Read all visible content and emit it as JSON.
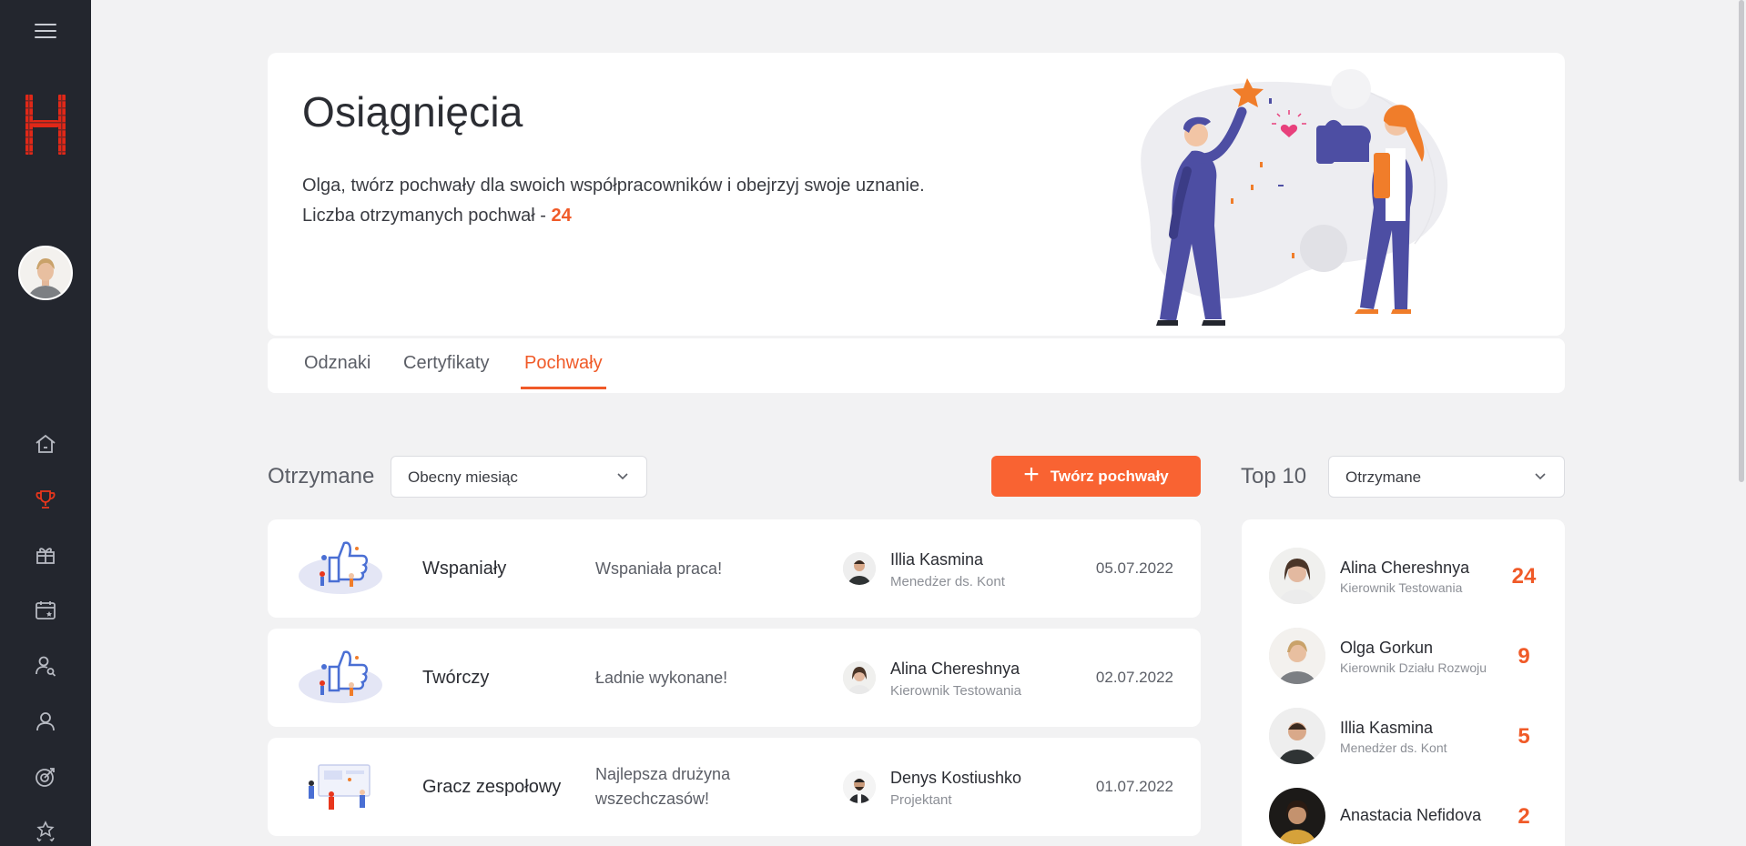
{
  "sidebar": {
    "items": [
      {
        "icon": "home-icon"
      },
      {
        "icon": "trophy-icon",
        "active": true
      },
      {
        "icon": "gift-icon"
      },
      {
        "icon": "calendar-star-icon"
      },
      {
        "icon": "user-search-icon"
      },
      {
        "icon": "user-icon"
      },
      {
        "icon": "target-icon"
      },
      {
        "icon": "stars-icon"
      }
    ],
    "accent": "#e8361c"
  },
  "hero": {
    "title": "Osiągnięcia",
    "line1": "Olga, twórz pochwały dla swoich współpracowników i obejrzyj swoje uznanie.",
    "line2_prefix": "Liczba otrzymanych pochwał - ",
    "line2_count": "24"
  },
  "tabs": [
    {
      "label": "Odznaki"
    },
    {
      "label": "Certyfikaty"
    },
    {
      "label": "Pochwały",
      "active": true
    }
  ],
  "received": {
    "label": "Otrzymane",
    "period_select": "Obecny miesiąc",
    "create_button": "Twórz pochwały",
    "rows": [
      {
        "title": "Wspaniały",
        "message": "Wspaniała praca!",
        "person": "Illia Kasmina",
        "role": "Menedżer ds. Kont",
        "date": "05.07.2022"
      },
      {
        "title": "Twórczy",
        "message": "Ładnie wykonane!",
        "person": "Alina Chereshnya",
        "role": "Kierownik Testowania",
        "date": "02.07.2022"
      },
      {
        "title": "Gracz zespołowy",
        "message": "Najlepsza drużyna wszechczasów!",
        "person": "Denys Kostiushko",
        "role": "Projektant",
        "date": "01.07.2022"
      }
    ]
  },
  "top10": {
    "label": "Top 10",
    "select": "Otrzymane",
    "items": [
      {
        "name": "Alina Chereshnya",
        "role": "Kierownik Testowania",
        "score": "24"
      },
      {
        "name": "Olga Gorkun",
        "role": "Kierownik Działu Rozwoju",
        "score": "9"
      },
      {
        "name": "Illia Kasmina",
        "role": "Menedżer ds. Kont",
        "score": "5"
      },
      {
        "name": "Anastacia Nefidova",
        "role": "",
        "score": "2"
      }
    ]
  },
  "colors": {
    "accent": "#f05a28",
    "button": "#f96332",
    "sidebar_bg": "#23262e",
    "page_bg": "#f2f2f3"
  }
}
